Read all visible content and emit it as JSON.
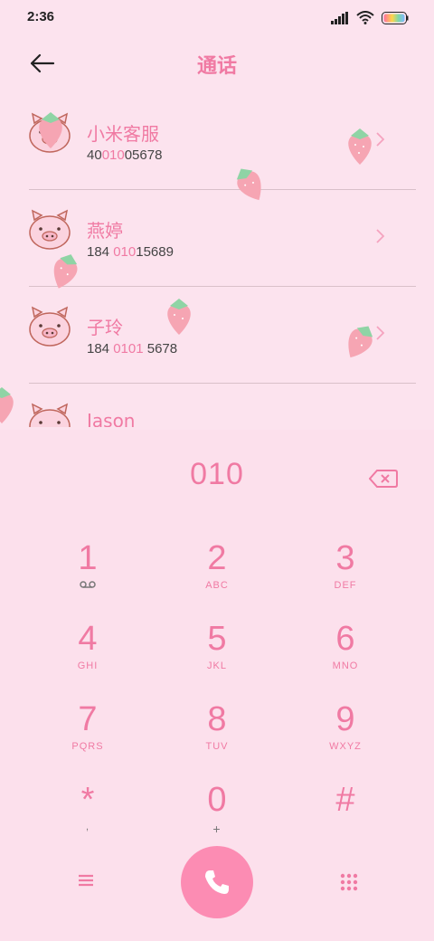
{
  "status": {
    "time": "2:36"
  },
  "header": {
    "title": "通话"
  },
  "contacts": [
    {
      "name": "小米客服",
      "num_pre": "40",
      "num_hl": "010",
      "num_post": "05678"
    },
    {
      "name": "燕婷",
      "num_pre": "184 ",
      "num_hl": "010",
      "num_post": "15689"
    },
    {
      "name": "子玲",
      "num_pre": "184 ",
      "num_hl": "0101",
      "num_post": " 5678"
    },
    {
      "name": "Jason",
      "num_pre": "",
      "num_hl": "",
      "num_post": ""
    }
  ],
  "dialer": {
    "typed_number": "010",
    "keys": [
      {
        "digit": "1",
        "letters": ""
      },
      {
        "digit": "2",
        "letters": "ABC"
      },
      {
        "digit": "3",
        "letters": "DEF"
      },
      {
        "digit": "4",
        "letters": "GHI"
      },
      {
        "digit": "5",
        "letters": "JKL"
      },
      {
        "digit": "6",
        "letters": "MNO"
      },
      {
        "digit": "7",
        "letters": "PQRS"
      },
      {
        "digit": "8",
        "letters": "TUV"
      },
      {
        "digit": "9",
        "letters": "WXYZ"
      },
      {
        "digit": "*",
        "letters": ","
      },
      {
        "digit": "0",
        "letters": "+"
      },
      {
        "digit": "#",
        "letters": ""
      }
    ]
  },
  "colors": {
    "accent": "#f07aa3",
    "background": "#fce3ee",
    "call_button": "#fc8cb3"
  },
  "icons": [
    "back-arrow-icon",
    "chevron-right-icon",
    "pig-avatar-icon",
    "strawberry-icon",
    "backspace-icon",
    "voicemail-icon",
    "menu-icon",
    "phone-icon",
    "dialpad-grid-icon"
  ]
}
